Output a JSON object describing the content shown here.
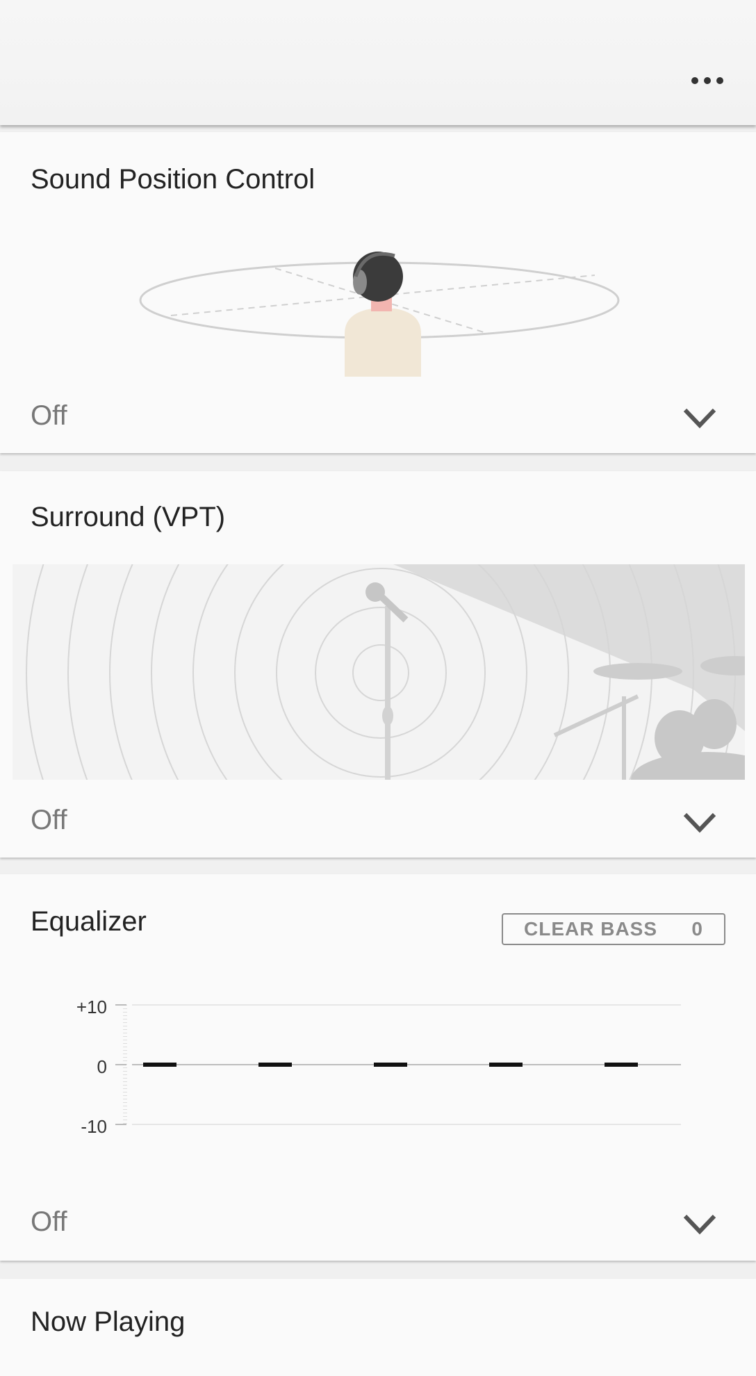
{
  "header": {
    "more_icon": "more-horizontal-icon"
  },
  "sections": {
    "sound_position": {
      "title": "Sound Position Control",
      "status": "Off"
    },
    "surround": {
      "title": "Surround (VPT)",
      "status": "Off"
    },
    "equalizer": {
      "title": "Equalizer",
      "status": "Off",
      "clear_bass": {
        "label": "CLEAR BASS",
        "value": "0"
      },
      "y_labels": {
        "top": "+10",
        "mid": "0",
        "bottom": "-10"
      }
    },
    "now_playing": {
      "title": "Now Playing"
    }
  },
  "chart_data": {
    "type": "line",
    "ylim": [
      -10,
      10
    ],
    "series": [
      {
        "values": [
          0,
          0,
          0,
          0,
          0
        ]
      }
    ]
  }
}
